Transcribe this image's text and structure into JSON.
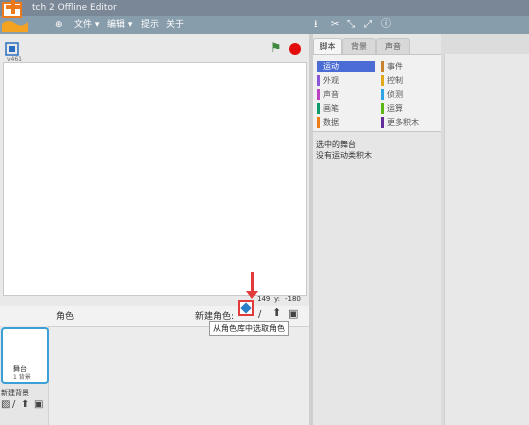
{
  "window": {
    "title": "tch 2 Offline Editor"
  },
  "menu": {
    "globe_label": "⊕",
    "items": [
      "文件 ▾",
      "编辑 ▾",
      "提示",
      "关于"
    ]
  },
  "toolbar_icons": [
    "stamp-icon",
    "cut-icon",
    "grow-icon",
    "shrink-icon",
    "help-icon"
  ],
  "stage": {
    "version": "v461"
  },
  "coords": {
    "x_label": "x:",
    "x_value": "149",
    "y_label": "y:",
    "y_value": "-180"
  },
  "sprites": {
    "header_label": "角色",
    "new_sprite_label": "新建角色:",
    "tooltip": "从角色库中选取角色",
    "stage_thumb_label": "舞台",
    "stage_thumb_count": "1 背景",
    "new_backdrop_label": "新建背景"
  },
  "palette": {
    "tabs": [
      "脚本",
      "背景",
      "声音"
    ],
    "categories": [
      {
        "label": "运动",
        "color": "#4a6cd4"
      },
      {
        "label": "事件",
        "color": "#c88330"
      },
      {
        "label": "外观",
        "color": "#8a55d7"
      },
      {
        "label": "控制",
        "color": "#e1a91a"
      },
      {
        "label": "声音",
        "color": "#bb42c3"
      },
      {
        "label": "侦测",
        "color": "#2ca5e2"
      },
      {
        "label": "画笔",
        "color": "#0e9a6c"
      },
      {
        "label": "运算",
        "color": "#5cb712"
      },
      {
        "label": "数据",
        "color": "#ee7d16"
      },
      {
        "label": "更多积木",
        "color": "#632d99"
      }
    ],
    "selected_sprite_text": "选中的舞台",
    "no_blocks_text": "没有运动类积木"
  },
  "colors": {
    "accent": "#4a6cd4",
    "highlight": "#e23b3b",
    "title_bar": "#7a8796",
    "menu_bar": "#889dab"
  }
}
